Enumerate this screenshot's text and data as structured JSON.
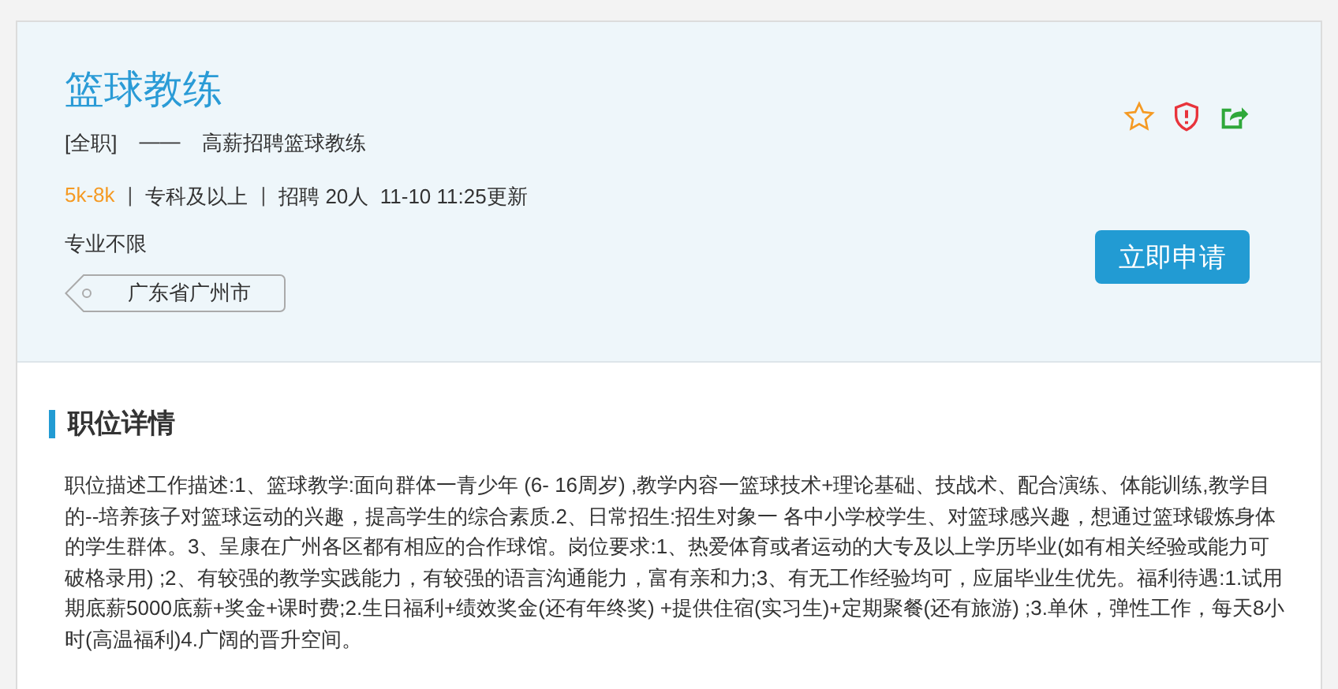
{
  "job": {
    "title": "篮球教练",
    "type": "[全职]",
    "dash": "——",
    "subtitle": "高薪招聘篮球教练",
    "meta": [
      {
        "kind": "salary",
        "text": "5k-8k"
      },
      {
        "kind": "sep",
        "text": "|"
      },
      {
        "kind": "plain",
        "text": "专科及以上"
      },
      {
        "kind": "sep",
        "text": "|"
      },
      {
        "kind": "plain",
        "text": "招聘 20人  11-10 11:25更新"
      }
    ],
    "major": "专业不限",
    "location": "广东省广州市",
    "apply": "立即申请"
  },
  "details": {
    "heading": "职位详情",
    "text": "职位描述工作描述:1、篮球教学:面向群体一青少年 (6- 16周岁) ,教学内容一篮球技术+理论基础、技战术、配合演练、体能训练,教学目的--培养孩子对篮球运动的兴趣，提高学生的综合素质.2、日常招生:招生对象一 各中小学校学生、对篮球感兴趣，想通过篮球锻炼身体的学生群体。3、呈康在广州各区都有相应的合作球馆。岗位要求:1、热爱体育或者运动的大专及以上学历毕业(如有相关经验或能力可破格录用) ;2、有较强的教学实践能力，有较强的语言沟通能力，富有亲和力;3、有无工作经验均可，应届毕业生优先。福利待遇:1.试用期底薪5000底薪+奖金+课时费;2.生日福利+绩效奖金(还有年终奖) +提供住宿(实习生)+定期聚餐(还有旅游) ;3.单休，弹性工作，每天8小时(高温福利)4.广阔的晋升空间。"
  }
}
